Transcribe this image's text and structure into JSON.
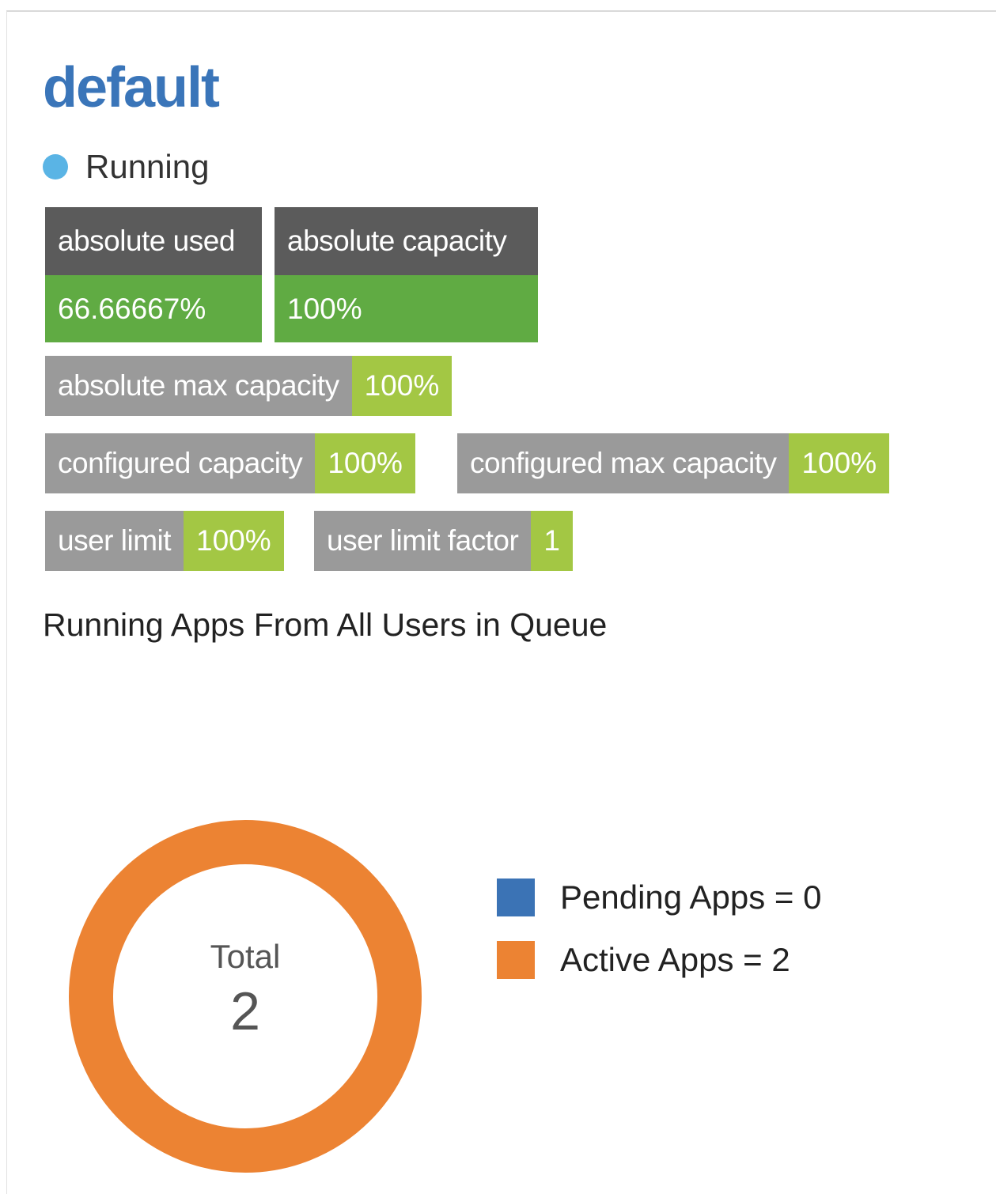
{
  "queue": {
    "name": "default",
    "status": "Running",
    "status_color": "#5ab4e5"
  },
  "metrics": {
    "absolute_used": {
      "label": "absolute used",
      "value": "66.66667%"
    },
    "absolute_capacity": {
      "label": "absolute capacity",
      "value": "100%"
    },
    "absolute_max_capacity": {
      "label": "absolute max capacity",
      "value": "100%"
    },
    "configured_capacity": {
      "label": "configured capacity",
      "value": "100%"
    },
    "configured_max_capacity": {
      "label": "configured max capacity",
      "value": "100%"
    },
    "user_limit": {
      "label": "user limit",
      "value": "100%"
    },
    "user_limit_factor": {
      "label": "user limit factor",
      "value": "1"
    }
  },
  "apps_section": {
    "title": "Running Apps From All Users in Queue",
    "total_label": "Total",
    "total_value": "2",
    "legend": [
      {
        "label": "Pending Apps = 0",
        "color": "#3b73b5"
      },
      {
        "label": "Active Apps = 2",
        "color": "#ec8333"
      }
    ]
  },
  "chart_data": {
    "type": "pie",
    "categories": [
      "Pending Apps",
      "Active Apps"
    ],
    "values": [
      0,
      2
    ],
    "colors": [
      "#3b73b5",
      "#ec8333"
    ],
    "center_label": "Total",
    "center_value": 2,
    "legend_position": "right"
  },
  "colors": {
    "title_blue": "#3a75b9",
    "header_dark_gray": "#5b5b5b",
    "value_green": "#60ab43",
    "label_gray": "#9a9a9a",
    "value_light_green": "#a3c744"
  }
}
